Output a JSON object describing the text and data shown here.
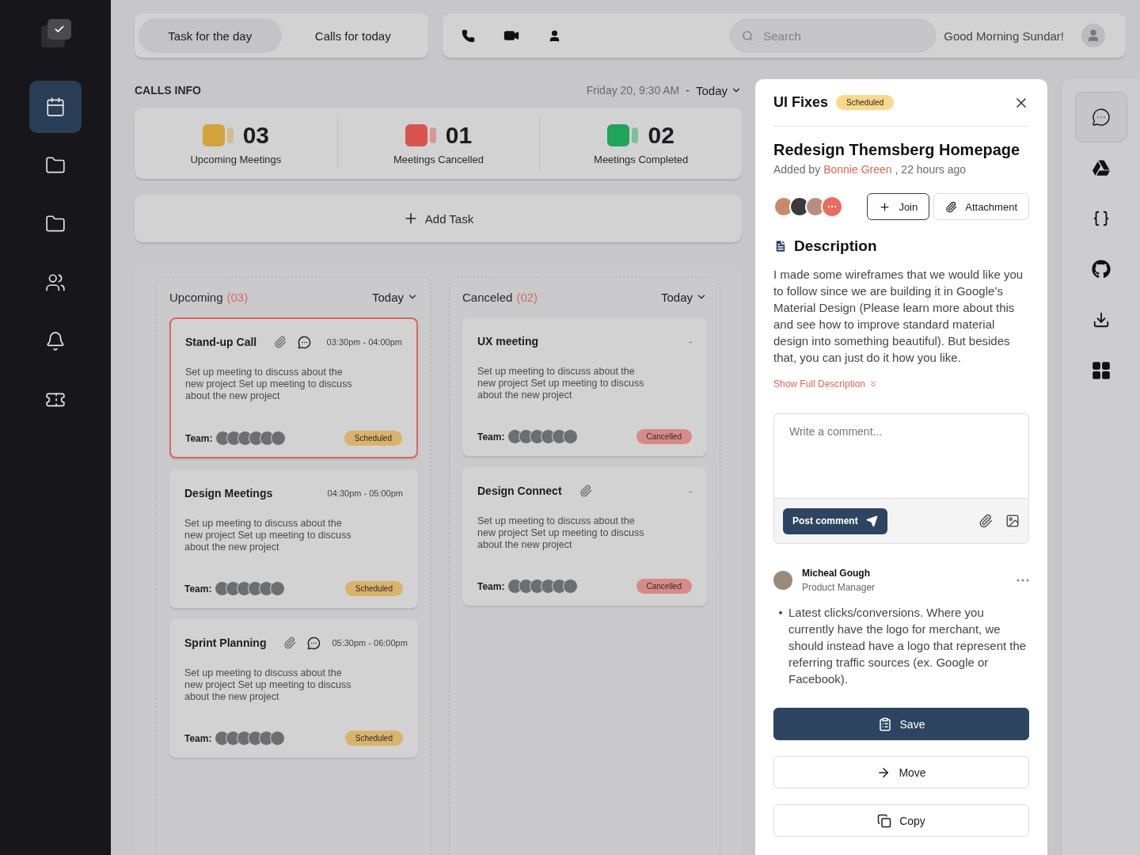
{
  "sidebar": {
    "items": [
      {
        "kind": "calendar",
        "selected": true
      },
      {
        "kind": "folder",
        "selected": false
      },
      {
        "kind": "folder",
        "selected": false
      },
      {
        "kind": "users",
        "selected": false
      },
      {
        "kind": "bell",
        "selected": false
      },
      {
        "kind": "ticket",
        "selected": false
      }
    ]
  },
  "tabs": [
    {
      "label": "Task for the day",
      "selected": true
    },
    {
      "label": "Calls for today",
      "selected": false
    }
  ],
  "toolbar": {
    "search": {
      "placeholder": "Search"
    },
    "greeting": "Good Morning Sundar!"
  },
  "calls_info": {
    "title": "CALLS INFO",
    "date": "Friday 20, 9:30 AM",
    "separator": "-",
    "filter": "Today",
    "stats": [
      {
        "count": "03",
        "label": "Upcoming Meetings",
        "color": "#d4a23a"
      },
      {
        "count": "01",
        "label": "Meetings Cancelled",
        "color": "#d9534f"
      },
      {
        "count": "02",
        "label": "Meetings Completed",
        "color": "#1fa45a"
      }
    ]
  },
  "add_task": "Add Task",
  "columns": [
    {
      "title": "Upcoming",
      "count": "(03)",
      "filter": "Today",
      "cards": [
        {
          "title": "Stand-up Call",
          "attachment": true,
          "comments": true,
          "time": "03:30pm - 04:00pm",
          "description": "Set up meeting to discuss about the new project Set up meeting to discuss about the new project",
          "team_label": "Team:",
          "status": {
            "kind": "scheduled",
            "label": "Scheduled"
          },
          "selected": true
        },
        {
          "title": "Design Meetings",
          "attachment": false,
          "comments": false,
          "time": "04:30pm - 05:00pm",
          "description": "Set up meeting to discuss about the new project Set up meeting to discuss about the new project",
          "team_label": "Team:",
          "status": {
            "kind": "scheduled",
            "label": "Scheduled"
          },
          "selected": false
        },
        {
          "title": "Sprint Planning",
          "attachment": true,
          "comments": true,
          "time": "05:30pm - 06:00pm",
          "description": "Set up meeting to discuss about the new project Set up meeting to discuss about the new project",
          "team_label": "Team:",
          "status": {
            "kind": "scheduled",
            "label": "Scheduled"
          },
          "selected": false
        }
      ]
    },
    {
      "title": "Canceled",
      "count": "(02)",
      "filter": "Today",
      "cards": [
        {
          "title": "UX meeting",
          "attachment": false,
          "comments": false,
          "time": "-",
          "description": "Set up meeting to discuss about the new project Set up meeting to discuss about the new project",
          "team_label": "Team:",
          "status": {
            "kind": "cancelled",
            "label": "Cancelled"
          },
          "selected": false
        },
        {
          "title": "Design Connect",
          "attachment": true,
          "comments": false,
          "time": "-",
          "description": "Set up meeting to discuss about the new project Set up meeting to discuss about the new project",
          "team_label": "Team:",
          "status": {
            "kind": "cancelled",
            "label": "Cancelled"
          },
          "selected": false
        }
      ]
    }
  ],
  "detail": {
    "title": "UI Fixes",
    "badge": "Scheduled",
    "heading": "Redesign Themsberg Homepage",
    "added_prefix": "Added by",
    "author": "Bonnie Green",
    "added_suffix": ", 22 hours ago",
    "join": "Join",
    "attachment": "Attachment",
    "description_title": "Description",
    "description": "I made some wireframes that we would like you to follow since we are building it in Google’s Material Design (Please learn more about this and see how to improve standard material design into something beautiful). But besides that, you can just do it how you like.",
    "show_more": "Show Full Description",
    "comment_placeholder": "Write a comment...",
    "post": "Post comment",
    "comment": {
      "author": "Micheal Gough",
      "role": "Product Manager",
      "text": "Latest clicks/conversions. Where you currently have the logo for merchant, we should instead have a logo that represent the referring traffic sources (ex. Google or Facebook)."
    },
    "actions": [
      {
        "kind": "save",
        "label": "Save"
      },
      {
        "kind": "move",
        "label": "Move"
      },
      {
        "kind": "copy",
        "label": "Copy"
      }
    ]
  },
  "rail": {
    "items": [
      {
        "kind": "chat",
        "selected": true
      },
      {
        "kind": "drive",
        "selected": false
      },
      {
        "kind": "braces",
        "selected": false
      },
      {
        "kind": "github",
        "selected": false
      },
      {
        "kind": "download",
        "selected": false
      },
      {
        "kind": "apps",
        "selected": false
      }
    ]
  }
}
